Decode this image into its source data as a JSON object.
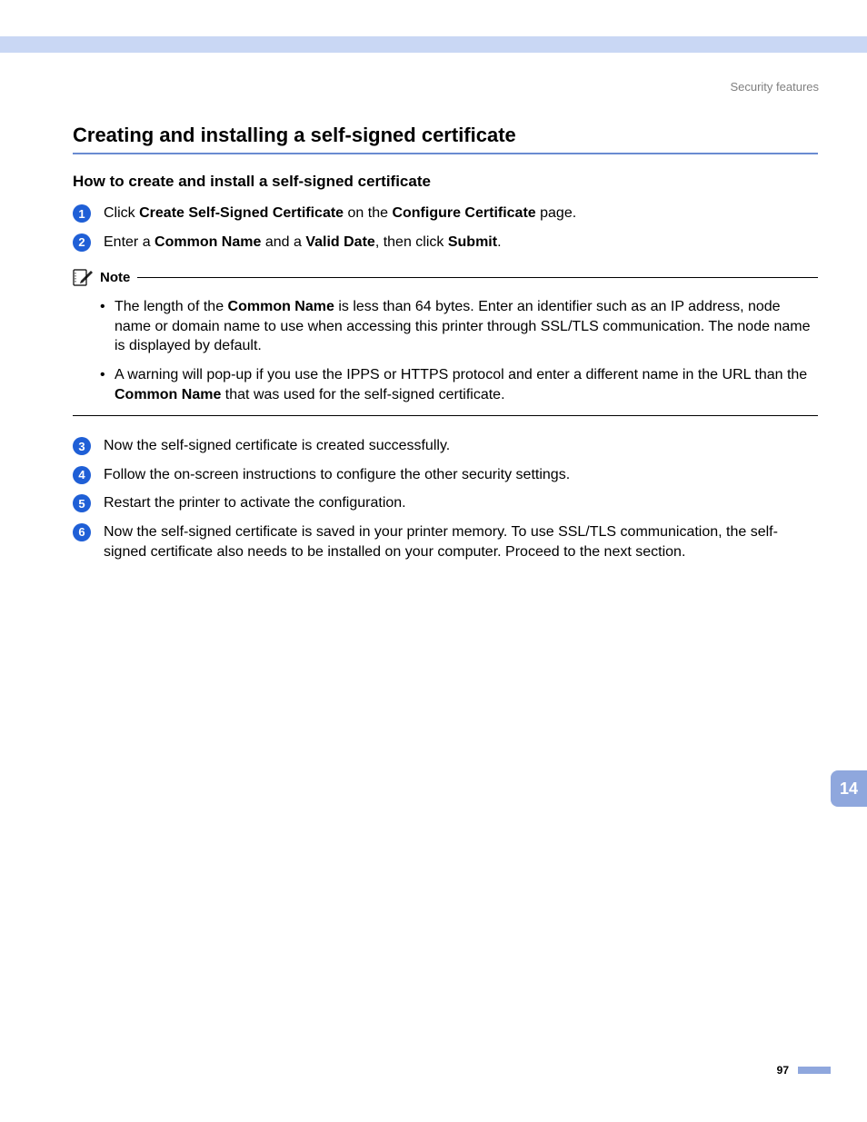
{
  "header_label": "Security features",
  "title": "Creating and installing a self-signed certificate",
  "subtitle": "How to create and install a self-signed certificate",
  "steps": {
    "s1": {
      "num": "1",
      "prefix": "Click ",
      "b1": "Create Self-Signed Certificate",
      "mid": " on the ",
      "b2": "Configure Certificate",
      "suffix": " page."
    },
    "s2": {
      "num": "2",
      "prefix": "Enter a ",
      "b1": "Common Name",
      "mid1": " and a ",
      "b2": "Valid Date",
      "mid2": ", then click ",
      "b3": "Submit",
      "suffix": "."
    },
    "s3": {
      "num": "3",
      "text": "Now the self-signed certificate is created successfully."
    },
    "s4": {
      "num": "4",
      "text": "Follow the on-screen instructions to configure the other security settings."
    },
    "s5": {
      "num": "5",
      "text": "Restart the printer to activate the configuration."
    },
    "s6": {
      "num": "6",
      "text": "Now the self-signed certificate is saved in your printer memory. To use SSL/TLS communication, the self-signed certificate also needs to be installed on your computer. Proceed to the next section."
    }
  },
  "note": {
    "label": "Note",
    "items": {
      "i1": {
        "prefix": "The length of the ",
        "b1": "Common Name",
        "suffix": " is less than 64 bytes. Enter an identifier such as an IP address, node name or domain name to use when accessing this printer through SSL/TLS communication. The node name is displayed by default."
      },
      "i2": {
        "prefix": "A warning will pop-up if you use the IPPS or HTTPS protocol and enter a different name in the URL than the ",
        "b1": "Common Name",
        "suffix": " that was used for the self-signed certificate."
      }
    }
  },
  "chapter": "14",
  "page_number": "97"
}
